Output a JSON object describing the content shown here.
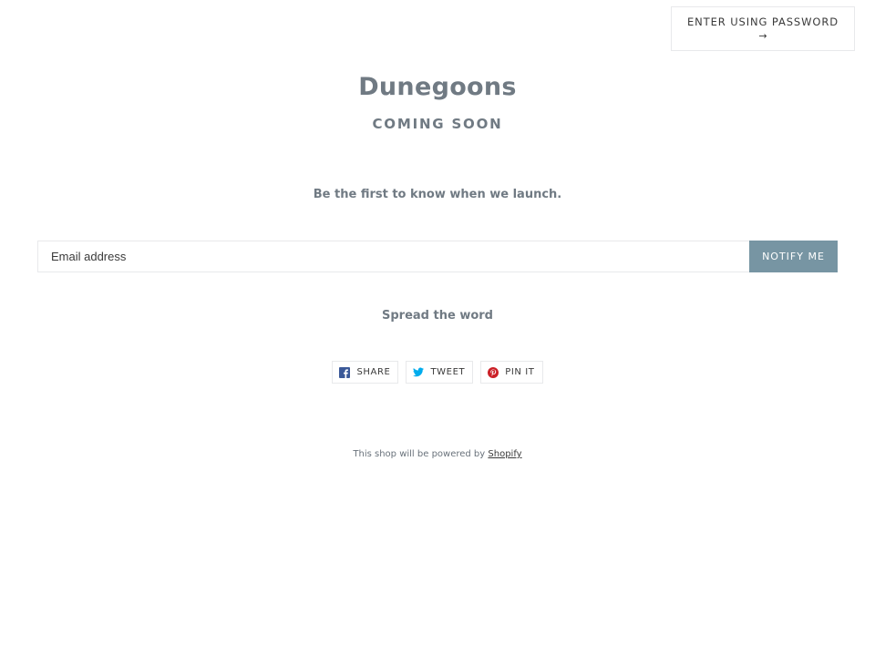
{
  "header": {
    "password_button": {
      "label": "ENTER USING PASSWORD",
      "arrow": "→"
    }
  },
  "main": {
    "shop_name": "Dunegoons",
    "status": "COMING SOON",
    "tagline": "Be the first to know when we launch.",
    "signup": {
      "email_placeholder": "Email address",
      "email_value": "",
      "submit_label": "NOTIFY ME"
    },
    "share": {
      "heading": "Spread the word",
      "buttons": [
        {
          "label": "SHARE",
          "icon": "facebook-icon",
          "color": "#3b5998"
        },
        {
          "label": "TWEET",
          "icon": "twitter-icon",
          "color": "#00aced"
        },
        {
          "label": "PIN IT",
          "icon": "pinterest-icon",
          "color": "#cb2027"
        }
      ]
    }
  },
  "footer": {
    "powered_text": "This shop will be powered by",
    "powered_link": "Shopify"
  },
  "colors": {
    "accent": "#7795a3",
    "text": "#707a83",
    "border": "#e8e9eb"
  }
}
